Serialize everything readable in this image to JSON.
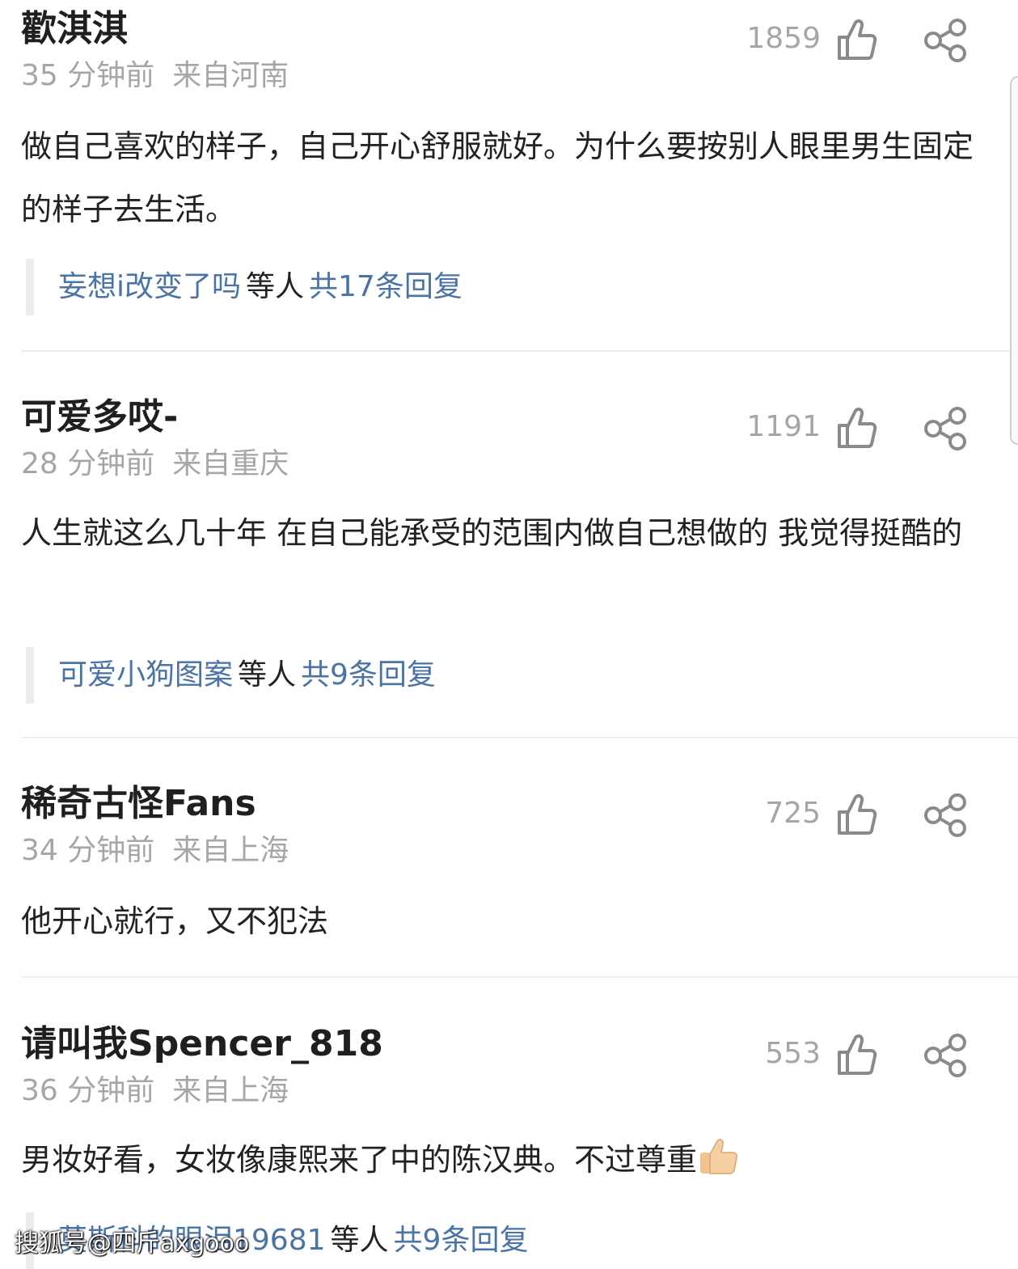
{
  "comments": [
    {
      "username": "歡淇淇",
      "time": "35 分钟前",
      "location": "来自河南",
      "likes": "1859",
      "text": "做自己喜欢的样子，自己开心舒服就好。为什么要按别人眼里男生固定的样子去生活。",
      "reply_name": "妄想i改变了吗",
      "reply_etc": "等人",
      "reply_total": "共17条回复"
    },
    {
      "username": "可爱多哎-",
      "time": "28 分钟前",
      "location": "来自重庆",
      "likes": "1191",
      "text": "人生就这么几十年 在自己能承受的范围内做自己想做的 我觉得挺酷的",
      "reply_name": "可爱小狗图案",
      "reply_etc": "等人",
      "reply_total": "共9条回复"
    },
    {
      "username": "稀奇古怪Fans",
      "time": "34 分钟前",
      "location": "来自上海",
      "likes": "725",
      "text": "他开心就行，又不犯法"
    },
    {
      "username": "请叫我Spencer_818",
      "time": "36 分钟前",
      "location": "来自上海",
      "likes": "553",
      "text": "男妆好看，女妆像康熙来了中的陈汉典。不过尊重",
      "reply_name": "莫斯科的眼泪19681",
      "reply_etc": "等人",
      "reply_total": "共9条回复"
    }
  ],
  "icons": {
    "like": "thumbs-up-outline-icon",
    "share": "share-icon",
    "emoji": "thumbs-up-emoji"
  },
  "colors": {
    "link": "#4a73a6",
    "meta": "#a6a6a6",
    "text": "#222222"
  },
  "watermark": "搜狐号@四斤axgooo"
}
